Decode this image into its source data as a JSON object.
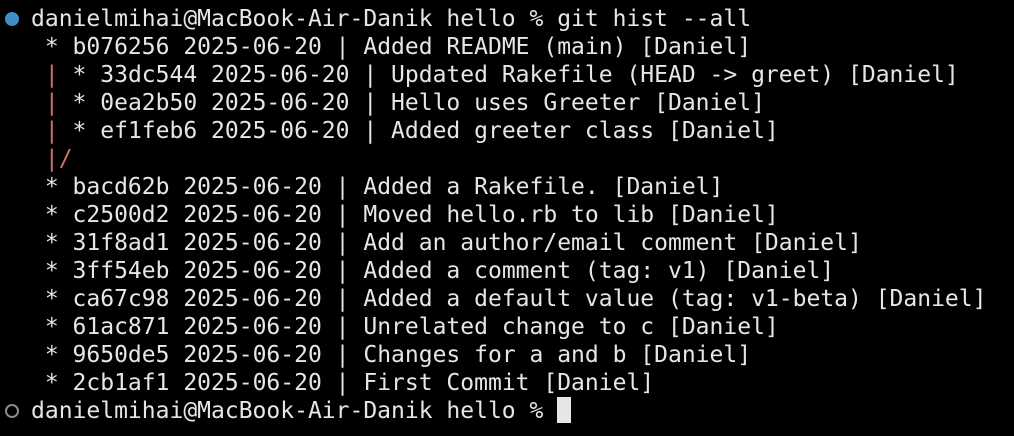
{
  "prompt": {
    "user_host": "danielmihai@MacBook-Air-Danik",
    "directory": "hello",
    "symbol": "%"
  },
  "command": "git hist --all",
  "commit_prefix": "* ",
  "branch_rail": "| ",
  "merge_rail": "|/",
  "commits": [
    {
      "hash": "b076256",
      "date": "2025-06-20",
      "message": "Added README (main) [Daniel]",
      "rail": ""
    },
    {
      "hash": "33dc544",
      "date": "2025-06-20",
      "message": "Updated Rakefile (HEAD -> greet) [Daniel]",
      "rail": "| "
    },
    {
      "hash": "0ea2b50",
      "date": "2025-06-20",
      "message": "Hello uses Greeter [Daniel]",
      "rail": "| "
    },
    {
      "hash": "ef1feb6",
      "date": "2025-06-20",
      "message": "Added greeter class [Daniel]",
      "rail": "| "
    },
    {
      "hash": "bacd62b",
      "date": "2025-06-20",
      "message": "Added a Rakefile. [Daniel]",
      "rail": ""
    },
    {
      "hash": "c2500d2",
      "date": "2025-06-20",
      "message": "Moved hello.rb to lib [Daniel]",
      "rail": ""
    },
    {
      "hash": "31f8ad1",
      "date": "2025-06-20",
      "message": "Add an author/email comment [Daniel]",
      "rail": ""
    },
    {
      "hash": "3ff54eb",
      "date": "2025-06-20",
      "message": "Added a comment (tag: v1) [Daniel]",
      "rail": ""
    },
    {
      "hash": "ca67c98",
      "date": "2025-06-20",
      "message": "Added a default value (tag: v1-beta) [Daniel]",
      "rail": ""
    },
    {
      "hash": "61ac871",
      "date": "2025-06-20",
      "message": "Unrelated change to c [Daniel]",
      "rail": ""
    },
    {
      "hash": "9650de5",
      "date": "2025-06-20",
      "message": "Changes for a and b [Daniel]",
      "rail": ""
    },
    {
      "hash": "2cb1af1",
      "date": "2025-06-20",
      "message": "First Commit [Daniel]",
      "rail": ""
    }
  ],
  "colors": {
    "background": "#000000",
    "text": "#e6e6e6",
    "branch_line": "#d06f68",
    "marker_success": "#3d8fc6",
    "marker_pending": "#8a8a8a"
  }
}
